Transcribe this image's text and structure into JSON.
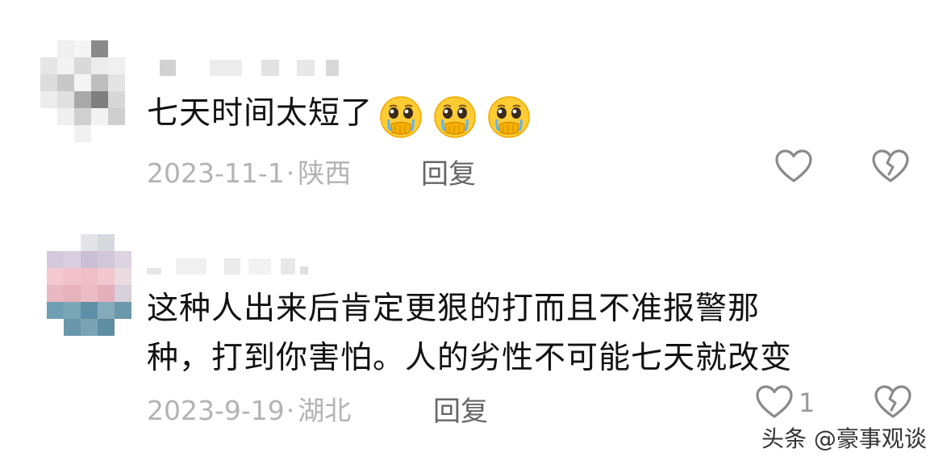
{
  "comments": [
    {
      "text": "七天时间太短了",
      "emoji_icons": [
        "pleading-face-icon",
        "pleading-face-icon",
        "pleading-face-icon"
      ],
      "date": "2023-11-1",
      "separator": "·",
      "location": "陕西",
      "reply_label": "回复",
      "like_count": "",
      "like_icon": "heart-outline-icon",
      "dislike_icon": "broken-heart-outline-icon"
    },
    {
      "text_line1": "这种人出来后肯定更狠的打而且不准报警那",
      "text_line2": "种，打到你害怕。人的劣性不可能七天就改变",
      "date": "2023-9-19",
      "separator": "·",
      "location": "湖北",
      "reply_label": "回复",
      "like_count": "1",
      "like_icon": "heart-outline-icon",
      "dislike_icon": "broken-heart-outline-icon"
    }
  ],
  "watermark": "头条 @豪事观谈",
  "colors": {
    "text": "#111111",
    "meta": "#b3b3b3",
    "reply": "#666666",
    "icon_stroke": "#8a8a8a",
    "background": "#ffffff"
  }
}
